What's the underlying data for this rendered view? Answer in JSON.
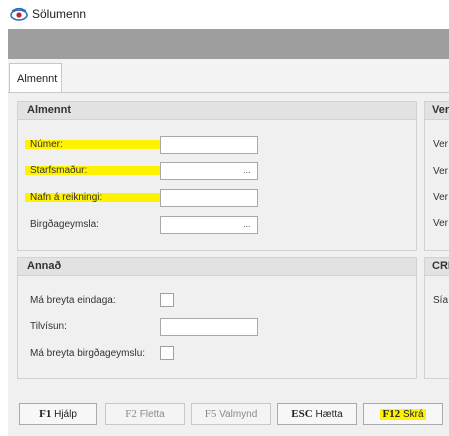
{
  "window": {
    "title": "Sölumenn"
  },
  "tabs": [
    {
      "label": "Almennt"
    }
  ],
  "almennt_panel": {
    "title": "Almennt",
    "fields": [
      {
        "label": "Númer:",
        "value": ""
      },
      {
        "label": "Starfsmaður:",
        "value": "",
        "lookup": "..."
      },
      {
        "label": "Nafn á reikningi:",
        "value": ""
      },
      {
        "label": "Birgðageymsla:",
        "value": "",
        "lookup": "..."
      }
    ]
  },
  "annad_panel": {
    "title": "Annað",
    "fields": [
      {
        "label": "Má breyta eindaga:"
      },
      {
        "label": "Tilvísun:",
        "value": ""
      },
      {
        "label": "Má breyta birgðageymslu:"
      }
    ]
  },
  "right_panel_top": {
    "title": "Ver",
    "rows": [
      "Ver",
      "Ver",
      "Ver",
      "Ver"
    ]
  },
  "right_panel_bottom": {
    "title": "CRI",
    "rows": [
      "Sía"
    ]
  },
  "footer": {
    "buttons": [
      {
        "key": "F1",
        "label": "Hjálp"
      },
      {
        "key": "F2",
        "label": "Fletta"
      },
      {
        "key": "F5",
        "label": "Valmynd"
      },
      {
        "key": "ESC",
        "label": "Hætta"
      },
      {
        "key": "F12",
        "label": "Skrá"
      }
    ]
  },
  "colors": {
    "highlight": "#fff200",
    "toolbar": "#9e9e9e",
    "panel_header": "#e2e2e2"
  },
  "icons": {
    "app": "eye-icon"
  }
}
